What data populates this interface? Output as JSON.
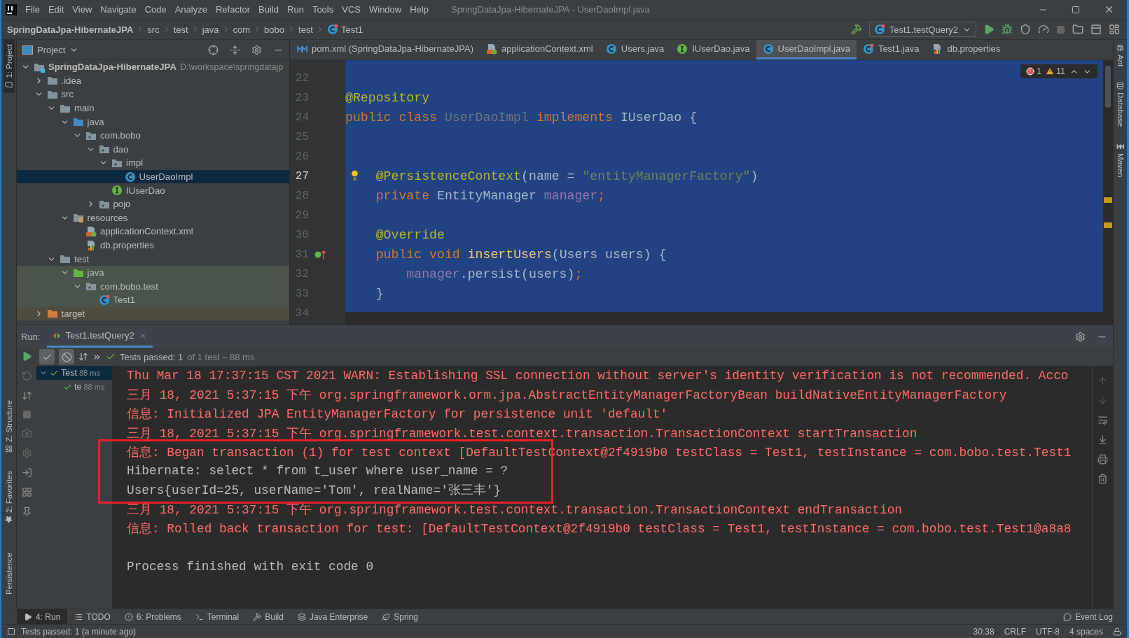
{
  "window": {
    "title": "SpringDataJpa-HibernateJPA - UserDaoImpl.java"
  },
  "menu": [
    "File",
    "Edit",
    "View",
    "Navigate",
    "Code",
    "Analyze",
    "Refactor",
    "Build",
    "Run",
    "Tools",
    "VCS",
    "Window",
    "Help"
  ],
  "breadcrumbs": [
    {
      "label": "SpringDataJpa-HibernateJPA",
      "kind": "module"
    },
    {
      "label": "src",
      "kind": "folder"
    },
    {
      "label": "test",
      "kind": "folder"
    },
    {
      "label": "java",
      "kind": "folder"
    },
    {
      "label": "com",
      "kind": "folder"
    },
    {
      "label": "bobo",
      "kind": "folder"
    },
    {
      "label": "test",
      "kind": "folder"
    },
    {
      "label": "Test1",
      "kind": "test-class"
    }
  ],
  "run_configuration": "Test1.testQuery2",
  "left_stripe": {
    "top": [
      {
        "label": "1: Project",
        "selected": true
      }
    ],
    "bottom": [
      {
        "label": "Z: Structure",
        "kind": "structure"
      },
      {
        "label": "2: Favorites",
        "kind": "favorites"
      },
      {
        "label": "Persistence",
        "kind": "plain"
      }
    ]
  },
  "right_stripe": [
    {
      "label": "Ant",
      "kind": "ant"
    },
    {
      "label": "Database",
      "kind": "database"
    },
    {
      "label": "Maven",
      "kind": "maven"
    }
  ],
  "project_panel": {
    "title": "Project",
    "tree": [
      {
        "label": "SpringDataJpa-HibernateJPA",
        "kind": "module",
        "path": "D:\\workspace\\springdatajp",
        "expanded": true,
        "selected": false,
        "children": [
          {
            "label": ".idea",
            "kind": "folder",
            "expanded": false,
            "selected": false
          },
          {
            "label": "src",
            "kind": "folder",
            "expanded": true,
            "selected": false,
            "children": [
              {
                "label": "main",
                "kind": "folder",
                "expanded": true,
                "selected": false,
                "children": [
                  {
                    "label": "java",
                    "kind": "source-root",
                    "expanded": true,
                    "selected": false,
                    "children": [
                      {
                        "label": "com.bobo",
                        "kind": "package",
                        "expanded": true,
                        "selected": false,
                        "children": [
                          {
                            "label": "dao",
                            "kind": "package",
                            "expanded": true,
                            "selected": false,
                            "children": [
                              {
                                "label": "impl",
                                "kind": "package",
                                "expanded": true,
                                "selected": false,
                                "children": [
                                  {
                                    "label": "UserDaoImpl",
                                    "kind": "class",
                                    "selected": true
                                  }
                                ]
                              },
                              {
                                "label": "IUserDao",
                                "kind": "interface",
                                "selected": false
                              }
                            ]
                          },
                          {
                            "label": "pojo",
                            "kind": "package",
                            "expanded": false,
                            "selected": false
                          }
                        ]
                      }
                    ]
                  },
                  {
                    "label": "resources",
                    "kind": "resource-root",
                    "expanded": true,
                    "selected": false,
                    "children": [
                      {
                        "label": "applicationContext.xml",
                        "kind": "xml",
                        "selected": false
                      },
                      {
                        "label": "db.properties",
                        "kind": "properties",
                        "selected": false
                      }
                    ]
                  }
                ]
              },
              {
                "label": "test",
                "kind": "folder",
                "expanded": true,
                "selected": false,
                "children": [
                  {
                    "label": "java",
                    "kind": "test-root",
                    "color": "#49544a",
                    "expanded": true,
                    "selected": false,
                    "children": [
                      {
                        "label": "com.bobo.test",
                        "kind": "package",
                        "color": "#49544a",
                        "expanded": true,
                        "selected": false,
                        "children": [
                          {
                            "label": "Test1",
                            "kind": "test-class",
                            "color": "#49544a",
                            "selected": false
                          }
                        ]
                      }
                    ]
                  }
                ]
              }
            ]
          },
          {
            "label": "target",
            "kind": "excluded",
            "color": "#4f4b41",
            "expanded": false,
            "selected": false
          }
        ]
      }
    ]
  },
  "editor": {
    "tabs": [
      {
        "label": "pom.xml (SpringDataJpa-HibernateJPA)",
        "kind": "maven",
        "selected": false
      },
      {
        "label": "applicationContext.xml",
        "kind": "xml",
        "selected": false
      },
      {
        "label": "Users.java",
        "kind": "class",
        "selected": false
      },
      {
        "label": "IUserDao.java",
        "kind": "interface",
        "selected": false
      },
      {
        "label": "UserDaoImpl.java",
        "kind": "class",
        "selected": true
      },
      {
        "label": "Test1.java",
        "kind": "test-class",
        "selected": false
      },
      {
        "label": "db.properties",
        "kind": "properties",
        "selected": false
      }
    ],
    "inspections": {
      "errors": "1",
      "warnings": "11"
    },
    "lines": [
      {
        "number": "22",
        "current": false
      },
      {
        "number": "23",
        "current": false,
        "tokens": [
          {
            "text": "@Repository",
            "kind": "annotation"
          }
        ]
      },
      {
        "number": "24",
        "current": false,
        "tokens": [
          {
            "text": "public class ",
            "kind": "keyword"
          },
          {
            "text": "UserDaoImpl ",
            "kind": "unused"
          },
          {
            "text": "implements ",
            "kind": "keyword"
          },
          {
            "text": "IUserDao {",
            "kind": "plain"
          }
        ]
      },
      {
        "number": "25",
        "current": false
      },
      {
        "number": "26",
        "current": false
      },
      {
        "number": "27",
        "current": true,
        "bulb": true,
        "tokens": [
          {
            "text": "    @PersistenceContext",
            "kind": "annotation"
          },
          {
            "text": "(name = ",
            "kind": "plain"
          },
          {
            "text": "\"entityManagerFactory\"",
            "kind": "string"
          },
          {
            "text": ")",
            "kind": "plain"
          }
        ]
      },
      {
        "number": "28",
        "current": false,
        "tokens": [
          {
            "text": "    private ",
            "kind": "keyword"
          },
          {
            "text": "EntityManager ",
            "kind": "plain"
          },
          {
            "text": "manager",
            "kind": "field"
          },
          {
            "text": ";",
            "kind": "keyword"
          }
        ]
      },
      {
        "number": "29",
        "current": false
      },
      {
        "number": "30",
        "current": false,
        "tokens": [
          {
            "text": "    @Override",
            "kind": "annotation"
          }
        ]
      },
      {
        "number": "31",
        "current": false,
        "implements_marker": true,
        "tokens": [
          {
            "text": "    public void ",
            "kind": "keyword"
          },
          {
            "text": "insertUsers",
            "kind": "method"
          },
          {
            "text": "(Users users) {",
            "kind": "plain"
          }
        ]
      },
      {
        "number": "32",
        "current": false,
        "tokens": [
          {
            "text": "        manager",
            "kind": "field"
          },
          {
            "text": ".persist(users)",
            "kind": "plain"
          },
          {
            "text": ";",
            "kind": "keyword"
          }
        ]
      },
      {
        "number": "33",
        "current": false,
        "tokens": [
          {
            "text": "    }",
            "kind": "plain"
          }
        ]
      },
      {
        "number": "34",
        "current": false
      }
    ]
  },
  "run_panel": {
    "label": "Run:",
    "tab": "Test1.testQuery2",
    "status": "Tests passed: 1",
    "status_detail": "of 1 test – 88 ms",
    "tests": [
      {
        "label": "Test",
        "time": "88 ms",
        "passed": true,
        "children": [
          {
            "label": "te",
            "time": "88 ms",
            "passed": true
          }
        ]
      }
    ],
    "console": [
      {
        "kind": "stderr",
        "highlighted": false,
        "text": "Thu Mar 18 17:37:15 CST 2021 WARN: Establishing SSL connection without server's identity verification is not recommended. Acco"
      },
      {
        "kind": "stderr",
        "highlighted": false,
        "text": "三月 18, 2021 5:37:15 下午 org.springframework.orm.jpa.AbstractEntityManagerFactoryBean buildNativeEntityManagerFactory"
      },
      {
        "kind": "stderr",
        "highlighted": false,
        "text": "信息: Initialized JPA EntityManagerFactory for persistence unit 'default'"
      },
      {
        "kind": "stderr",
        "highlighted": false,
        "text": "三月 18, 2021 5:37:15 下午 org.springframework.test.context.transaction.TransactionContext startTransaction"
      },
      {
        "kind": "stderr",
        "highlighted": true,
        "text": "信息: Began transaction (1) for test context [DefaultTestContext@2f4919b0 testClass = Test1, testInstance = com.bobo.test.Test1"
      },
      {
        "kind": "stdout",
        "highlighted": true,
        "text": "Hibernate: select * from t_user where user_name = ?"
      },
      {
        "kind": "stdout",
        "highlighted": true,
        "text": "Users{userId=25, userName='Tom', realName='张三丰'}"
      },
      {
        "kind": "stderr",
        "highlighted": false,
        "text": "三月 18, 2021 5:37:15 下午 org.springframework.test.context.transaction.TransactionContext endTransaction"
      },
      {
        "kind": "stderr",
        "highlighted": false,
        "text": "信息: Rolled back transaction for test: [DefaultTestContext@2f4919b0 testClass = Test1, testInstance = com.bobo.test.Test1@a8a8"
      },
      {
        "kind": "blank"
      },
      {
        "kind": "stdout",
        "highlighted": false,
        "text": "Process finished with exit code 0"
      }
    ]
  },
  "tool_tabs": [
    {
      "label": "4: Run",
      "kind": "run",
      "selected": true
    },
    {
      "label": "TODO",
      "kind": "todo",
      "selected": false
    },
    {
      "label": "6: Problems",
      "kind": "problems",
      "selected": false
    },
    {
      "label": "Terminal",
      "kind": "terminal",
      "selected": false
    },
    {
      "label": "Build",
      "kind": "build",
      "selected": false
    },
    {
      "label": "Java Enterprise",
      "kind": "enterprise",
      "selected": false
    },
    {
      "label": "Spring",
      "kind": "spring",
      "selected": false
    }
  ],
  "event_log": "Event Log",
  "status_bar": {
    "message": "Tests passed: 1 (a minute ago)",
    "items": [
      "30:38",
      "CRLF",
      "UTF-8",
      "4 spaces"
    ]
  }
}
